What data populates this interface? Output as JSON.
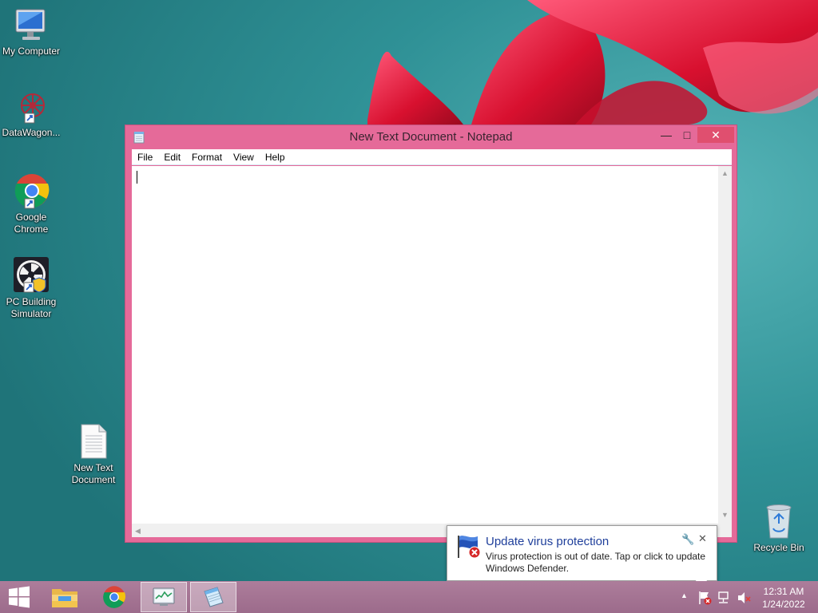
{
  "desktop": {
    "icons": [
      {
        "label": "My Computer",
        "icon": "computer-icon"
      },
      {
        "label": "DataWagon...",
        "icon": "datawagon-icon"
      },
      {
        "label": "Google Chrome",
        "icon": "chrome-icon"
      },
      {
        "label": "PC Building Simulator",
        "icon": "pc-building-simulator-icon"
      },
      {
        "label": "New Text Document",
        "icon": "text-document-icon"
      },
      {
        "label": "Recycle Bin",
        "icon": "recycle-bin-icon"
      }
    ]
  },
  "notepad": {
    "title": "New Text Document - Notepad",
    "menu": [
      "File",
      "Edit",
      "Format",
      "View",
      "Help"
    ],
    "content": "",
    "window_color": "#e56a99",
    "close_color": "#e04f6f"
  },
  "notification": {
    "title": "Update virus protection",
    "message": "Virus protection is out of date. Tap or click to update Windows Defender.",
    "icon": "security-flag-icon",
    "title_color": "#1f3f9b"
  },
  "taskbar": {
    "items": [
      "start-icon",
      "file-explorer-icon",
      "chrome-icon",
      "task-manager-icon",
      "notepad-icon"
    ],
    "active_item": "notepad-icon",
    "tray": [
      "show-hidden-icons",
      "action-center-flag-icon",
      "network-icon",
      "volume-muted-icon"
    ],
    "clock": {
      "time": "12:31 AM",
      "date": "1/24/2022"
    }
  }
}
